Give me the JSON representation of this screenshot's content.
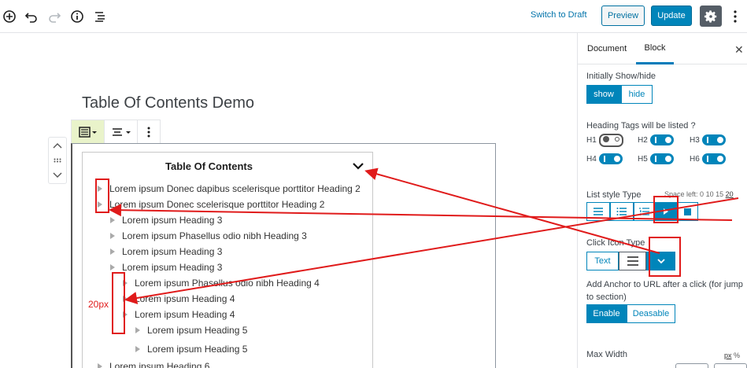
{
  "topbar": {
    "switch_to_draft": "Switch to Draft",
    "preview": "Preview",
    "update": "Update",
    "icons": [
      "add-block-icon",
      "undo-icon",
      "redo-icon",
      "info-icon",
      "outline-icon",
      "gear-icon",
      "more-icon"
    ]
  },
  "editor": {
    "post_title": "Table Of Contents Demo",
    "toc": {
      "title": "Table Of Contents",
      "items": [
        {
          "level": 2,
          "text": "Lorem ipsum Donec dapibus scelerisque porttitor Heading 2"
        },
        {
          "level": 2,
          "text": "Lorem ipsum Donec scelerisque porttitor Heading 2"
        },
        {
          "level": 3,
          "text": "Lorem ipsum Heading 3"
        },
        {
          "level": 3,
          "text": "Lorem ipsum Phasellus odio nibh Heading 3"
        },
        {
          "level": 3,
          "text": "Lorem ipsum Heading 3"
        },
        {
          "level": 3,
          "text": "Lorem ipsum Heading 3"
        },
        {
          "level": 4,
          "text": "Lorem ipsum Phasellus odio nibh Heading 4"
        },
        {
          "level": 4,
          "text": "Lorem ipsum Heading 4"
        },
        {
          "level": 4,
          "text": "Lorem ipsum Heading 4"
        },
        {
          "level": 5,
          "text": "Lorem ipsum Heading 5"
        },
        {
          "level": 5,
          "text": "Lorem ipsum Heading 5"
        },
        {
          "level": 6,
          "text": "Lorem ipsum Heading 6"
        }
      ]
    },
    "annotation_label": "20px"
  },
  "sidebar": {
    "tabs": [
      "Document",
      "Block"
    ],
    "active_tab": "Block",
    "show_hide_label": "Initially Show/hide",
    "show": "show",
    "hide": "hide",
    "heading_tags_label": "Heading Tags will be listed ?",
    "headings": [
      {
        "label": "H1",
        "on": false
      },
      {
        "label": "H2",
        "on": true
      },
      {
        "label": "H3",
        "on": true
      },
      {
        "label": "H4",
        "on": true
      },
      {
        "label": "H5",
        "on": true
      },
      {
        "label": "H6",
        "on": true
      }
    ],
    "list_style_label": "List style Type",
    "space_left_prefix": "Space left:",
    "space_left_values": [
      "0",
      "10",
      "15",
      "20"
    ],
    "space_left_selected": "20",
    "click_icon_label": "Click Icon Type",
    "click_icon_text": "Text",
    "anchor_label": "Add Anchor to URL after a click (for jump to section)",
    "enable": "Enable",
    "disable": "Deasable",
    "max_width_label": "Max Width",
    "unit_px": "px",
    "unit_pct": "%"
  },
  "colors": {
    "accent": "#0085ba",
    "annotation": "#e01b1b"
  }
}
